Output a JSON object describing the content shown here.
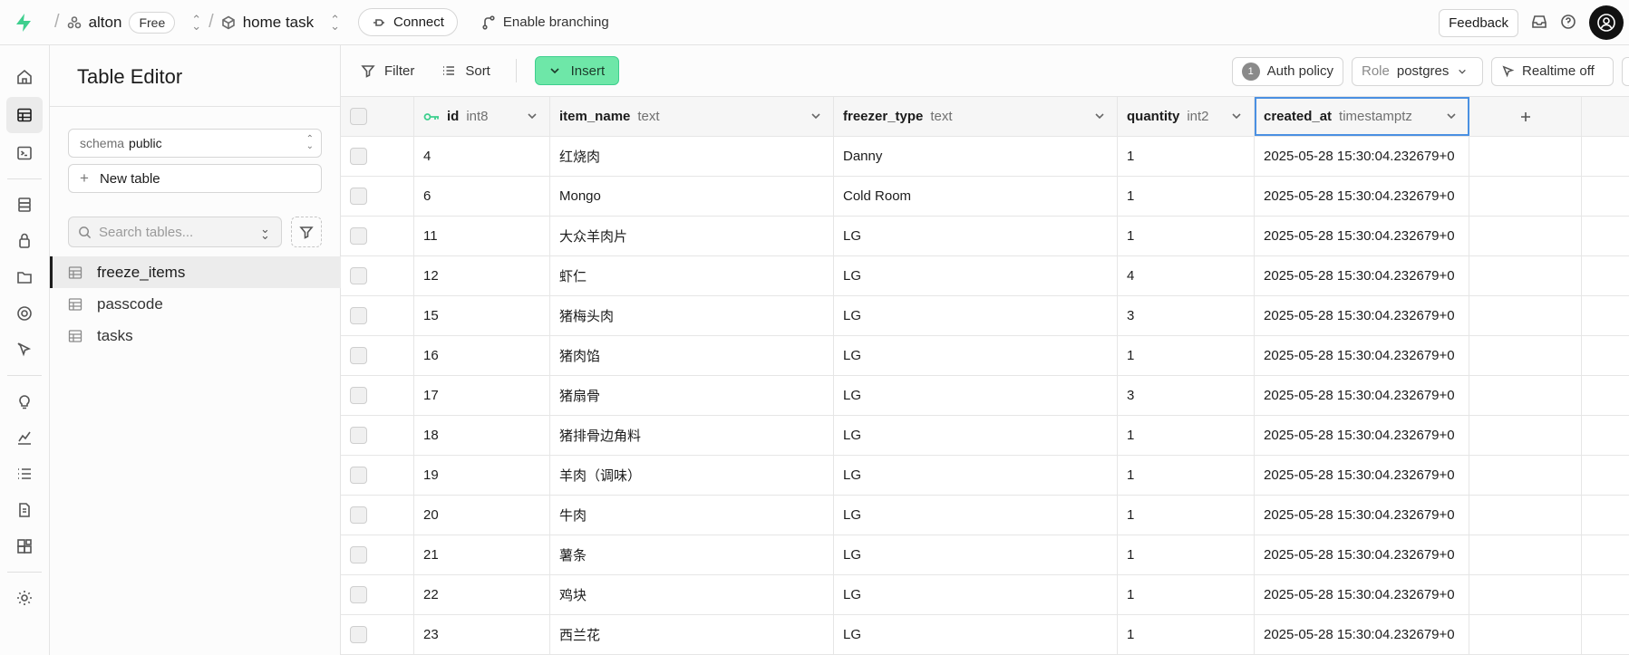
{
  "topbar": {
    "org": "alton",
    "plan": "Free",
    "project": "home task",
    "connect_label": "Connect",
    "branching_label": "Enable branching",
    "feedback_label": "Feedback"
  },
  "panel": {
    "title": "Table Editor",
    "schema_label": "schema",
    "schema_value": "public",
    "new_table_label": "New table",
    "search_placeholder": "Search tables...",
    "tables": [
      {
        "name": "freeze_items",
        "active": true
      },
      {
        "name": "passcode",
        "active": false
      },
      {
        "name": "tasks",
        "active": false
      }
    ]
  },
  "toolbar": {
    "filter_label": "Filter",
    "sort_label": "Sort",
    "insert_label": "Insert",
    "auth_count": "1",
    "auth_label": "Auth policy",
    "role_label": "Role",
    "role_value": "postgres",
    "realtime_label": "Realtime off"
  },
  "grid": {
    "columns": [
      {
        "name": "id",
        "type": "int8"
      },
      {
        "name": "item_name",
        "type": "text"
      },
      {
        "name": "freezer_type",
        "type": "text"
      },
      {
        "name": "quantity",
        "type": "int2"
      },
      {
        "name": "created_at",
        "type": "timestamptz"
      }
    ],
    "rows": [
      [
        "4",
        "红烧肉",
        "Danny",
        "1",
        "2025-05-28 15:30:04.232679+0"
      ],
      [
        "6",
        "Mongo",
        "Cold Room",
        "1",
        "2025-05-28 15:30:04.232679+0"
      ],
      [
        "11",
        "大众羊肉片",
        "LG",
        "1",
        "2025-05-28 15:30:04.232679+0"
      ],
      [
        "12",
        "虾仁",
        "LG",
        "4",
        "2025-05-28 15:30:04.232679+0"
      ],
      [
        "15",
        "猪梅头肉",
        "LG",
        "3",
        "2025-05-28 15:30:04.232679+0"
      ],
      [
        "16",
        "猪肉馅",
        "LG",
        "1",
        "2025-05-28 15:30:04.232679+0"
      ],
      [
        "17",
        "猪扇骨",
        "LG",
        "3",
        "2025-05-28 15:30:04.232679+0"
      ],
      [
        "18",
        "猪排骨边角料",
        "LG",
        "1",
        "2025-05-28 15:30:04.232679+0"
      ],
      [
        "19",
        "羊肉（调味）",
        "LG",
        "1",
        "2025-05-28 15:30:04.232679+0"
      ],
      [
        "20",
        "牛肉",
        "LG",
        "1",
        "2025-05-28 15:30:04.232679+0"
      ],
      [
        "21",
        "薯条",
        "LG",
        "1",
        "2025-05-28 15:30:04.232679+0"
      ],
      [
        "22",
        "鸡块",
        "LG",
        "1",
        "2025-05-28 15:30:04.232679+0"
      ],
      [
        "23",
        "西兰花",
        "LG",
        "1",
        "2025-05-28 15:30:04.232679+0"
      ]
    ]
  },
  "colors": {
    "brand": "#3ecf8e",
    "insert_bg": "#6ee7a8",
    "selected_outline": "#4a90e2"
  }
}
